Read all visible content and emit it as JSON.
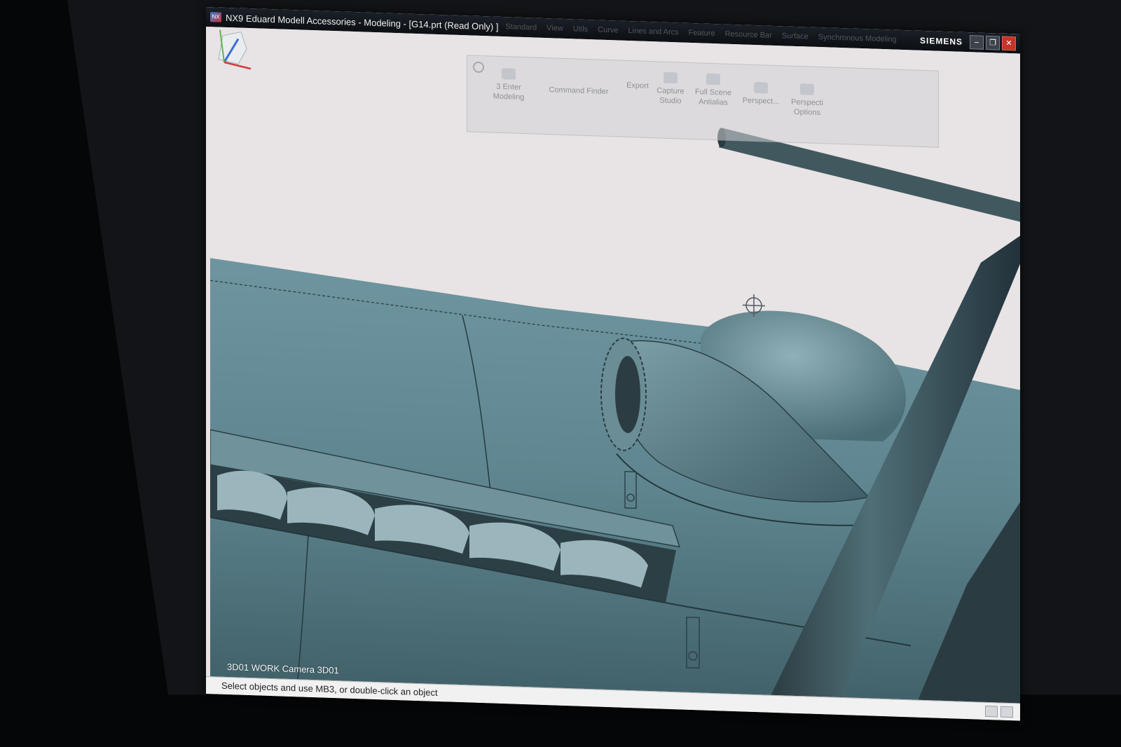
{
  "window": {
    "title": "NX9 Eduard Modell Accessories - Modeling - [G14.prt (Read Only) ]",
    "logo_text": "NX",
    "brand": "SIEMENS",
    "controls": {
      "minimize": "–",
      "restore": "❐",
      "close": "✕"
    }
  },
  "ribbon": {
    "tabs": [
      "Standard",
      "View",
      "Utils",
      "Curve",
      "Lines and Arcs",
      "Feature",
      "Resource Bar",
      "Surface",
      "Synchronous Modeling"
    ],
    "groups": [
      {
        "label_line1": "3 Enter",
        "label_line2": "Modeling"
      },
      {
        "label_line1": "Command Finder",
        "label_line2": ""
      },
      {
        "label_line1": "Export",
        "label_line2": ""
      },
      {
        "label_line1": "Capture",
        "label_line2": "Studio"
      },
      {
        "label_line1": "Full Scene",
        "label_line2": "Antialias"
      },
      {
        "label_line1": "Perspect...",
        "label_line2": ""
      },
      {
        "label_line1": "Perspecti",
        "label_line2": "Options"
      }
    ]
  },
  "viewport": {
    "camera_label": "3D01 WORK Camera 3D01",
    "model_color": "#5f8690",
    "background_color": "#e8e3e4"
  },
  "statusbar": {
    "message": "Select objects and use MB3, or double-click an object"
  },
  "icons": [
    "app-logo",
    "settings-icon",
    "view-triad-icon",
    "cursor-crosshair-icon"
  ]
}
